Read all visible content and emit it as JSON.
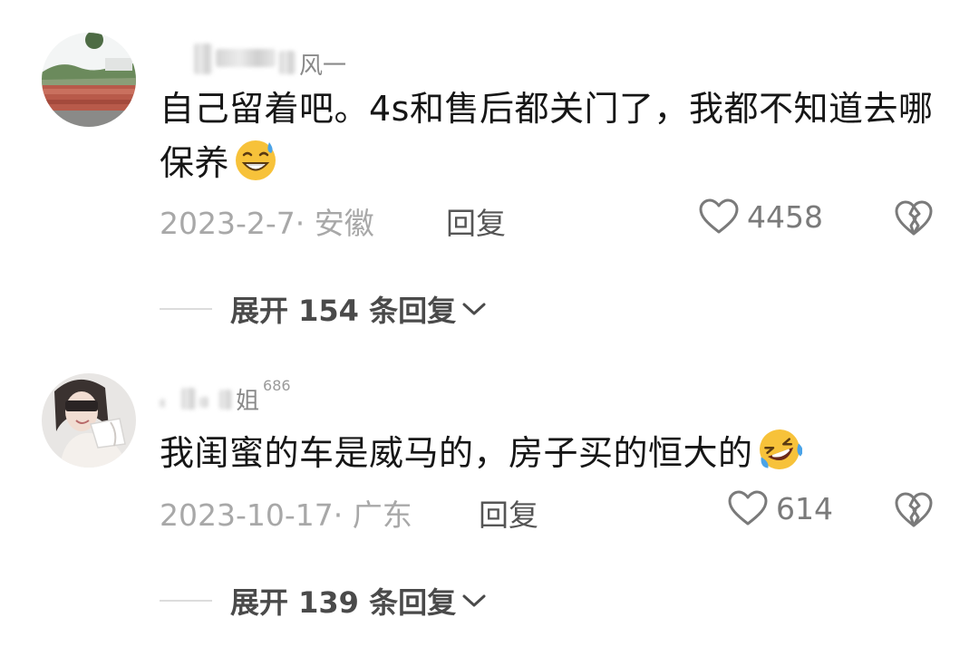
{
  "comments": [
    {
      "username_visible": "风一",
      "text": "自己留着吧。4s和售后都关门了，我都不知道去哪保养",
      "emoji": "grinning-sweat-emoji",
      "date": "2023-2-7· 安徽",
      "reply_label": "回复",
      "likes": "4458",
      "expand_label": "展开 154 条回复"
    },
    {
      "username_visible": "姐",
      "badge": "686",
      "text": "我闺蜜的车是威马的，房子买的恒大的",
      "emoji": "rolling-laughing-emoji",
      "date": "2023-10-17· 广东",
      "reply_label": "回复",
      "likes": "614",
      "expand_label": "展开 139 条回复"
    }
  ],
  "colors": {
    "text_primary": "#161616",
    "text_meta": "#a8a8a8",
    "text_action": "#555555",
    "expand_text": "#4a4a4a",
    "divider": "#dcdcdc",
    "emoji_yellow": "#f7c23a",
    "emoji_blue": "#4aa3e8"
  },
  "icons": [
    "heart-outline-icon",
    "broken-heart-icon",
    "chevron-down-icon"
  ]
}
